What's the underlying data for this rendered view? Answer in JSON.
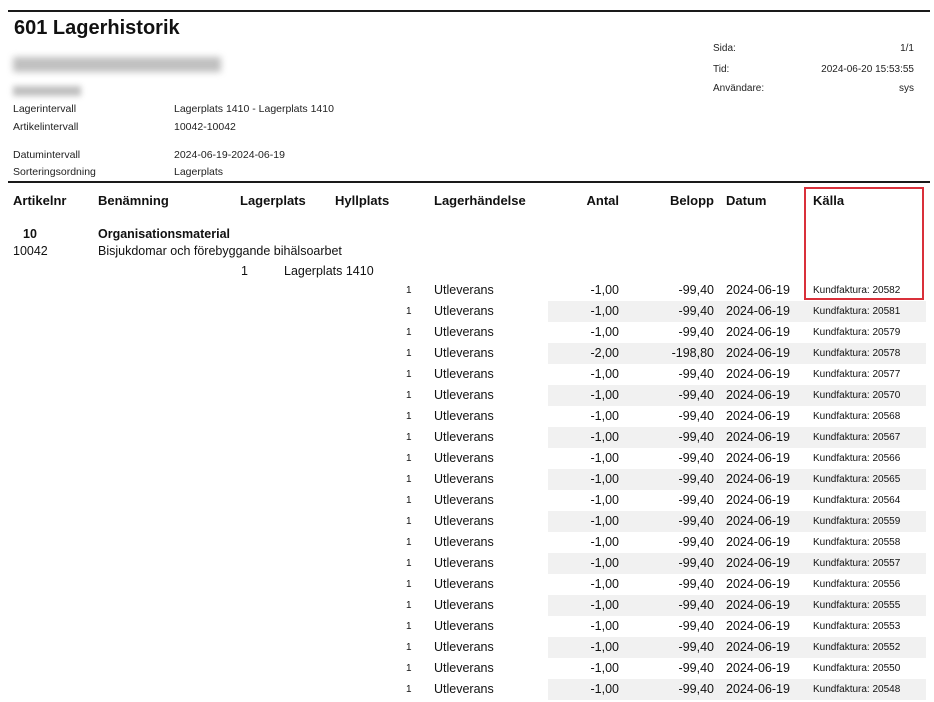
{
  "report": {
    "title": "601 Lagerhistorik",
    "meta": [
      {
        "label": "Sida:",
        "value": "1/1"
      },
      {
        "label": "Tid:",
        "value": "2024-06-20 15:53:55"
      },
      {
        "label": "Användare:",
        "value": "sys"
      }
    ],
    "info": [
      {
        "label": "Lagerintervall",
        "value": "Lagerplats 1410 - Lagerplats 1410"
      },
      {
        "label": "Artikelintervall",
        "value": "10042-10042"
      },
      {
        "label": "Datumintervall",
        "value": "2024-06-19-2024-06-19"
      },
      {
        "label": "Sorteringsordning",
        "value": "Lagerplats"
      }
    ]
  },
  "table": {
    "headers": {
      "article": "Artikelnr",
      "name": "Benämning",
      "location": "Lagerplats",
      "shelf": "Hyllplats",
      "event": "Lagerhändelse",
      "qty": "Antal",
      "amount": "Belopp",
      "date": "Datum",
      "source": "Källa"
    },
    "group": {
      "code": "10",
      "name": "Organisationsmaterial"
    },
    "article": {
      "number": "10042",
      "name": "Bisjukdomar och förebyggande bihälsoarbet"
    },
    "location": {
      "number": "1",
      "name": "Lagerplats 1410"
    },
    "rows": [
      {
        "n": "1",
        "event": "Utleverans",
        "qty": "-1,00",
        "amount": "-99,40",
        "date": "2024-06-19",
        "source": "Kundfaktura: 20582"
      },
      {
        "n": "1",
        "event": "Utleverans",
        "qty": "-1,00",
        "amount": "-99,40",
        "date": "2024-06-19",
        "source": "Kundfaktura: 20581"
      },
      {
        "n": "1",
        "event": "Utleverans",
        "qty": "-1,00",
        "amount": "-99,40",
        "date": "2024-06-19",
        "source": "Kundfaktura: 20579"
      },
      {
        "n": "1",
        "event": "Utleverans",
        "qty": "-2,00",
        "amount": "-198,80",
        "date": "2024-06-19",
        "source": "Kundfaktura: 20578"
      },
      {
        "n": "1",
        "event": "Utleverans",
        "qty": "-1,00",
        "amount": "-99,40",
        "date": "2024-06-19",
        "source": "Kundfaktura: 20577"
      },
      {
        "n": "1",
        "event": "Utleverans",
        "qty": "-1,00",
        "amount": "-99,40",
        "date": "2024-06-19",
        "source": "Kundfaktura: 20570"
      },
      {
        "n": "1",
        "event": "Utleverans",
        "qty": "-1,00",
        "amount": "-99,40",
        "date": "2024-06-19",
        "source": "Kundfaktura: 20568"
      },
      {
        "n": "1",
        "event": "Utleverans",
        "qty": "-1,00",
        "amount": "-99,40",
        "date": "2024-06-19",
        "source": "Kundfaktura: 20567"
      },
      {
        "n": "1",
        "event": "Utleverans",
        "qty": "-1,00",
        "amount": "-99,40",
        "date": "2024-06-19",
        "source": "Kundfaktura: 20566"
      },
      {
        "n": "1",
        "event": "Utleverans",
        "qty": "-1,00",
        "amount": "-99,40",
        "date": "2024-06-19",
        "source": "Kundfaktura: 20565"
      },
      {
        "n": "1",
        "event": "Utleverans",
        "qty": "-1,00",
        "amount": "-99,40",
        "date": "2024-06-19",
        "source": "Kundfaktura: 20564"
      },
      {
        "n": "1",
        "event": "Utleverans",
        "qty": "-1,00",
        "amount": "-99,40",
        "date": "2024-06-19",
        "source": "Kundfaktura: 20559"
      },
      {
        "n": "1",
        "event": "Utleverans",
        "qty": "-1,00",
        "amount": "-99,40",
        "date": "2024-06-19",
        "source": "Kundfaktura: 20558"
      },
      {
        "n": "1",
        "event": "Utleverans",
        "qty": "-1,00",
        "amount": "-99,40",
        "date": "2024-06-19",
        "source": "Kundfaktura: 20557"
      },
      {
        "n": "1",
        "event": "Utleverans",
        "qty": "-1,00",
        "amount": "-99,40",
        "date": "2024-06-19",
        "source": "Kundfaktura: 20556"
      },
      {
        "n": "1",
        "event": "Utleverans",
        "qty": "-1,00",
        "amount": "-99,40",
        "date": "2024-06-19",
        "source": "Kundfaktura: 20555"
      },
      {
        "n": "1",
        "event": "Utleverans",
        "qty": "-1,00",
        "amount": "-99,40",
        "date": "2024-06-19",
        "source": "Kundfaktura: 20553"
      },
      {
        "n": "1",
        "event": "Utleverans",
        "qty": "-1,00",
        "amount": "-99,40",
        "date": "2024-06-19",
        "source": "Kundfaktura: 20552"
      },
      {
        "n": "1",
        "event": "Utleverans",
        "qty": "-1,00",
        "amount": "-99,40",
        "date": "2024-06-19",
        "source": "Kundfaktura: 20550"
      },
      {
        "n": "1",
        "event": "Utleverans",
        "qty": "-1,00",
        "amount": "-99,40",
        "date": "2024-06-19",
        "source": "Kundfaktura: 20548"
      }
    ]
  },
  "colors": {
    "highlight": "#d9303a",
    "row_shade": "#f1f1f1"
  }
}
